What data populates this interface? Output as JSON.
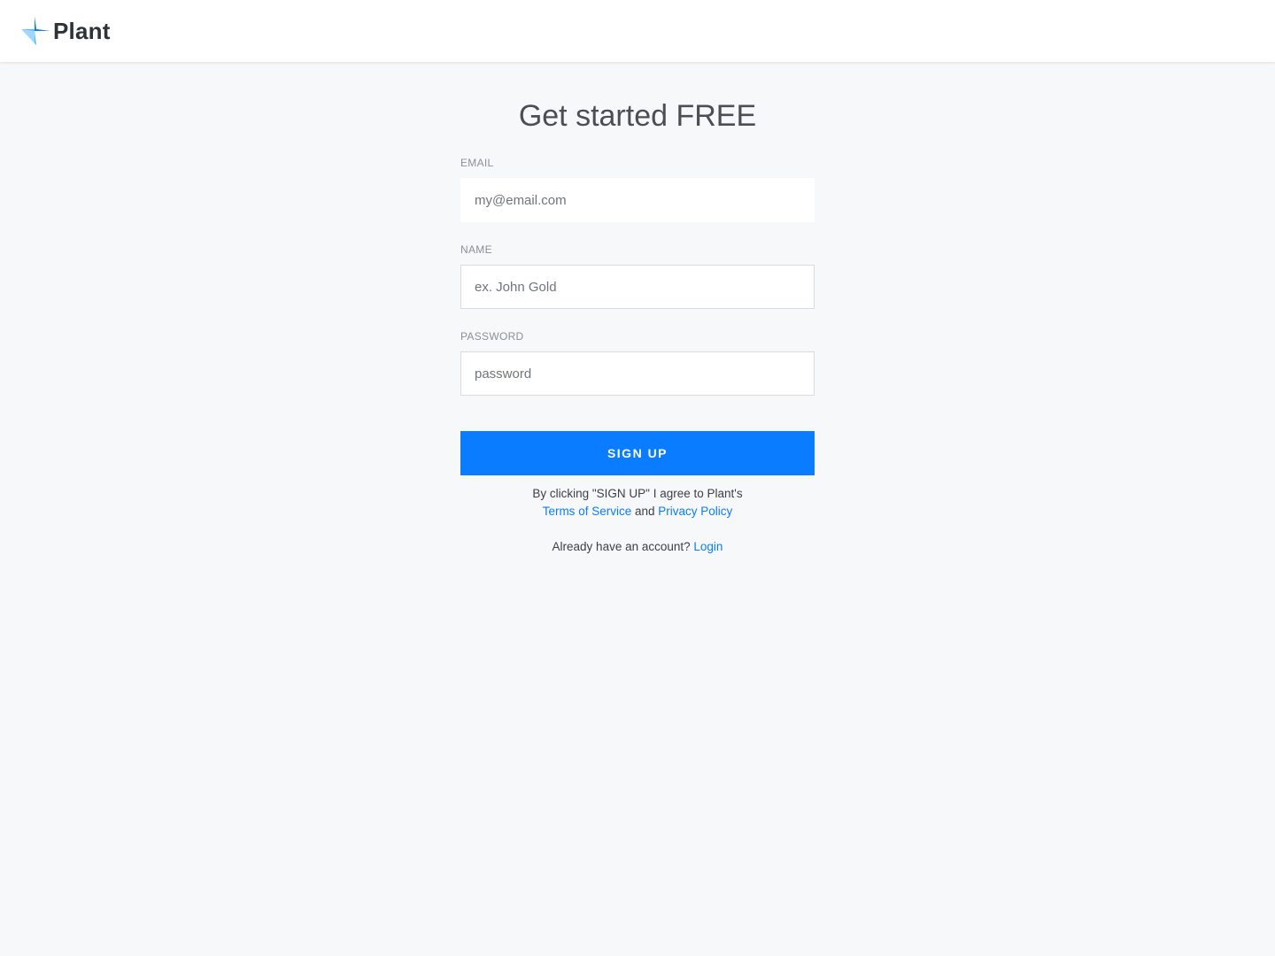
{
  "brand": {
    "name": "Plant",
    "logo_icon": "plant-star-logo-icon",
    "colors": {
      "primary": "#0a7cff",
      "light": "#5bb4ff"
    }
  },
  "form": {
    "title": "Get started FREE",
    "email": {
      "label": "EMAIL",
      "placeholder": "my@email.com",
      "value": ""
    },
    "name": {
      "label": "NAME",
      "placeholder": "ex. John Gold",
      "value": ""
    },
    "password": {
      "label": "PASSWORD",
      "placeholder": "password",
      "value": ""
    },
    "submit_label": "SIGN UP"
  },
  "legal": {
    "prefix": "By clicking \"SIGN UP\" I agree to Plant's",
    "terms_label": "Terms of Service",
    "connector": "and",
    "privacy_label": "Privacy Policy"
  },
  "login": {
    "prompt": "Already have an account?",
    "link_label": "Login"
  },
  "colors": {
    "accent": "#0a7cff",
    "background": "#f7f8fa",
    "surface": "#ffffff"
  }
}
